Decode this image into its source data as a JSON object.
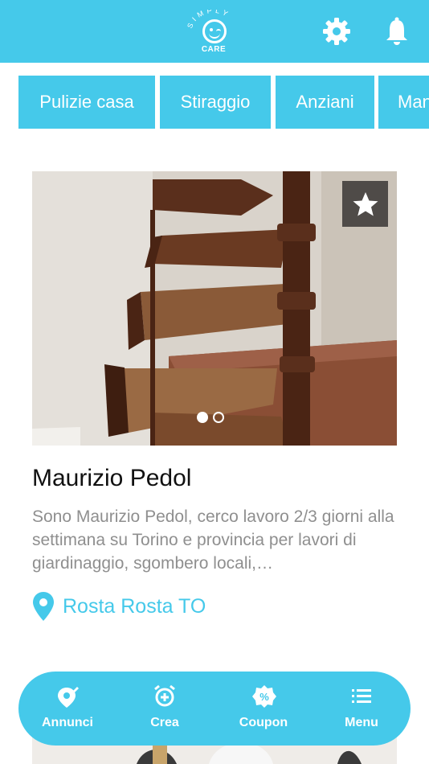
{
  "header": {
    "logo_arc_text": "SIMPLY",
    "logo_sub_text": "CARE",
    "icons": [
      "gear-icon",
      "bell-icon"
    ]
  },
  "categories": [
    {
      "label": "Pulizie casa"
    },
    {
      "label": "Stiraggio"
    },
    {
      "label": "Anziani"
    },
    {
      "label": "Man"
    }
  ],
  "listing": {
    "title": "Maurizio Pedol",
    "description": "Sono Maurizio Pedol,  cerco lavoro 2/3 giorni alla settimana su Torino e provincia per lavori di  giardinaggio, sgombero locali,…",
    "location": "Rosta Rosta TO",
    "carousel": {
      "current": 1,
      "total": 2
    },
    "favorite_icon": "star-icon"
  },
  "bottom_nav": {
    "items": [
      {
        "label": "Annunci",
        "icon": "tag-edit-icon"
      },
      {
        "label": "Crea",
        "icon": "alarm-add-icon"
      },
      {
        "label": "Coupon",
        "icon": "percent-badge-icon"
      },
      {
        "label": "Menu",
        "icon": "list-icon"
      }
    ]
  },
  "colors": {
    "accent": "#45c9ea",
    "text_dark": "#111111",
    "text_muted": "#8f8f8f",
    "favorite_bg": "#4f4b48"
  }
}
